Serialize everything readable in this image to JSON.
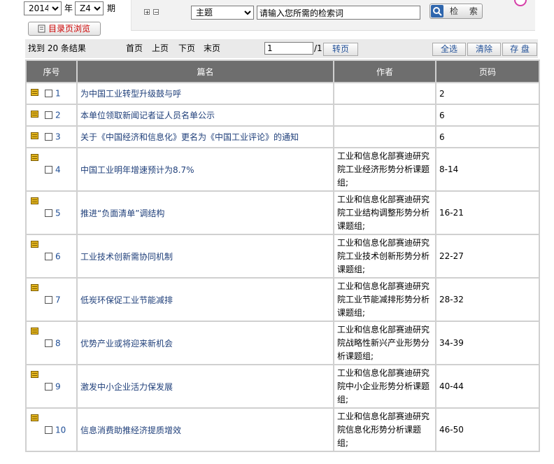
{
  "filter": {
    "year_value": "2014",
    "year_label": "年",
    "issue_value": "Z4",
    "issue_label": "期",
    "catalog_button": "目录页浏览"
  },
  "search": {
    "expand_symbol": "+",
    "collapse_symbol": "−",
    "field_value": "主题",
    "input_value": "请输入您所需的检索词",
    "button_label": "检 索"
  },
  "toolbar": {
    "result_text": "找到 20 条结果",
    "first": "首页",
    "prev": "上页",
    "next": "下页",
    "last": "末页",
    "page_value": "1",
    "page_total": "/1",
    "goto": "转页",
    "select_all": "全选",
    "clear": "清除",
    "save": "存 盘"
  },
  "table": {
    "headers": [
      "序号",
      "篇名",
      "作者",
      "页码"
    ],
    "rows": [
      {
        "no": "1",
        "title": "为中国工业转型升级鼓与呼",
        "author": "",
        "pages": "2"
      },
      {
        "no": "2",
        "title": "本单位领取新闻记者证人员名单公示",
        "author": "",
        "pages": "6"
      },
      {
        "no": "3",
        "title": "关于《中国经济和信息化》更名为《中国工业评论》的通知",
        "author": "",
        "pages": "6"
      },
      {
        "no": "4",
        "title": "中国工业明年增速预计为8.7%",
        "author": "工业和信息化部赛迪研究院工业经济形势分析课题组;",
        "pages": "8-14"
      },
      {
        "no": "5",
        "title": "推进“负面清单”调结构",
        "author": "工业和信息化部赛迪研究院工业结构调整形势分析课题组;",
        "pages": "16-21"
      },
      {
        "no": "6",
        "title": "工业技术创新需协同机制",
        "author": "工业和信息化部赛迪研究院工业技术创新形势分析课题组;",
        "pages": "22-27"
      },
      {
        "no": "7",
        "title": "低炭环保促工业节能减排",
        "author": "工业和信息化部赛迪研究院工业节能减排形势分析课题组;",
        "pages": "28-32"
      },
      {
        "no": "8",
        "title": "优势产业或将迎来新机会",
        "author": "工业和信息化部赛迪研究院战略性新兴产业形势分析课题组;",
        "pages": "34-39"
      },
      {
        "no": "9",
        "title": "激发中小企业活力保发展",
        "author": "工业和信息化部赛迪研究院中小企业形势分析课题组;",
        "pages": "40-44"
      },
      {
        "no": "10",
        "title": "信息消费助推经济提质增效",
        "author": "工业和信息化部赛迪研究院信息化形势分析课题组;",
        "pages": "46-50"
      }
    ]
  }
}
